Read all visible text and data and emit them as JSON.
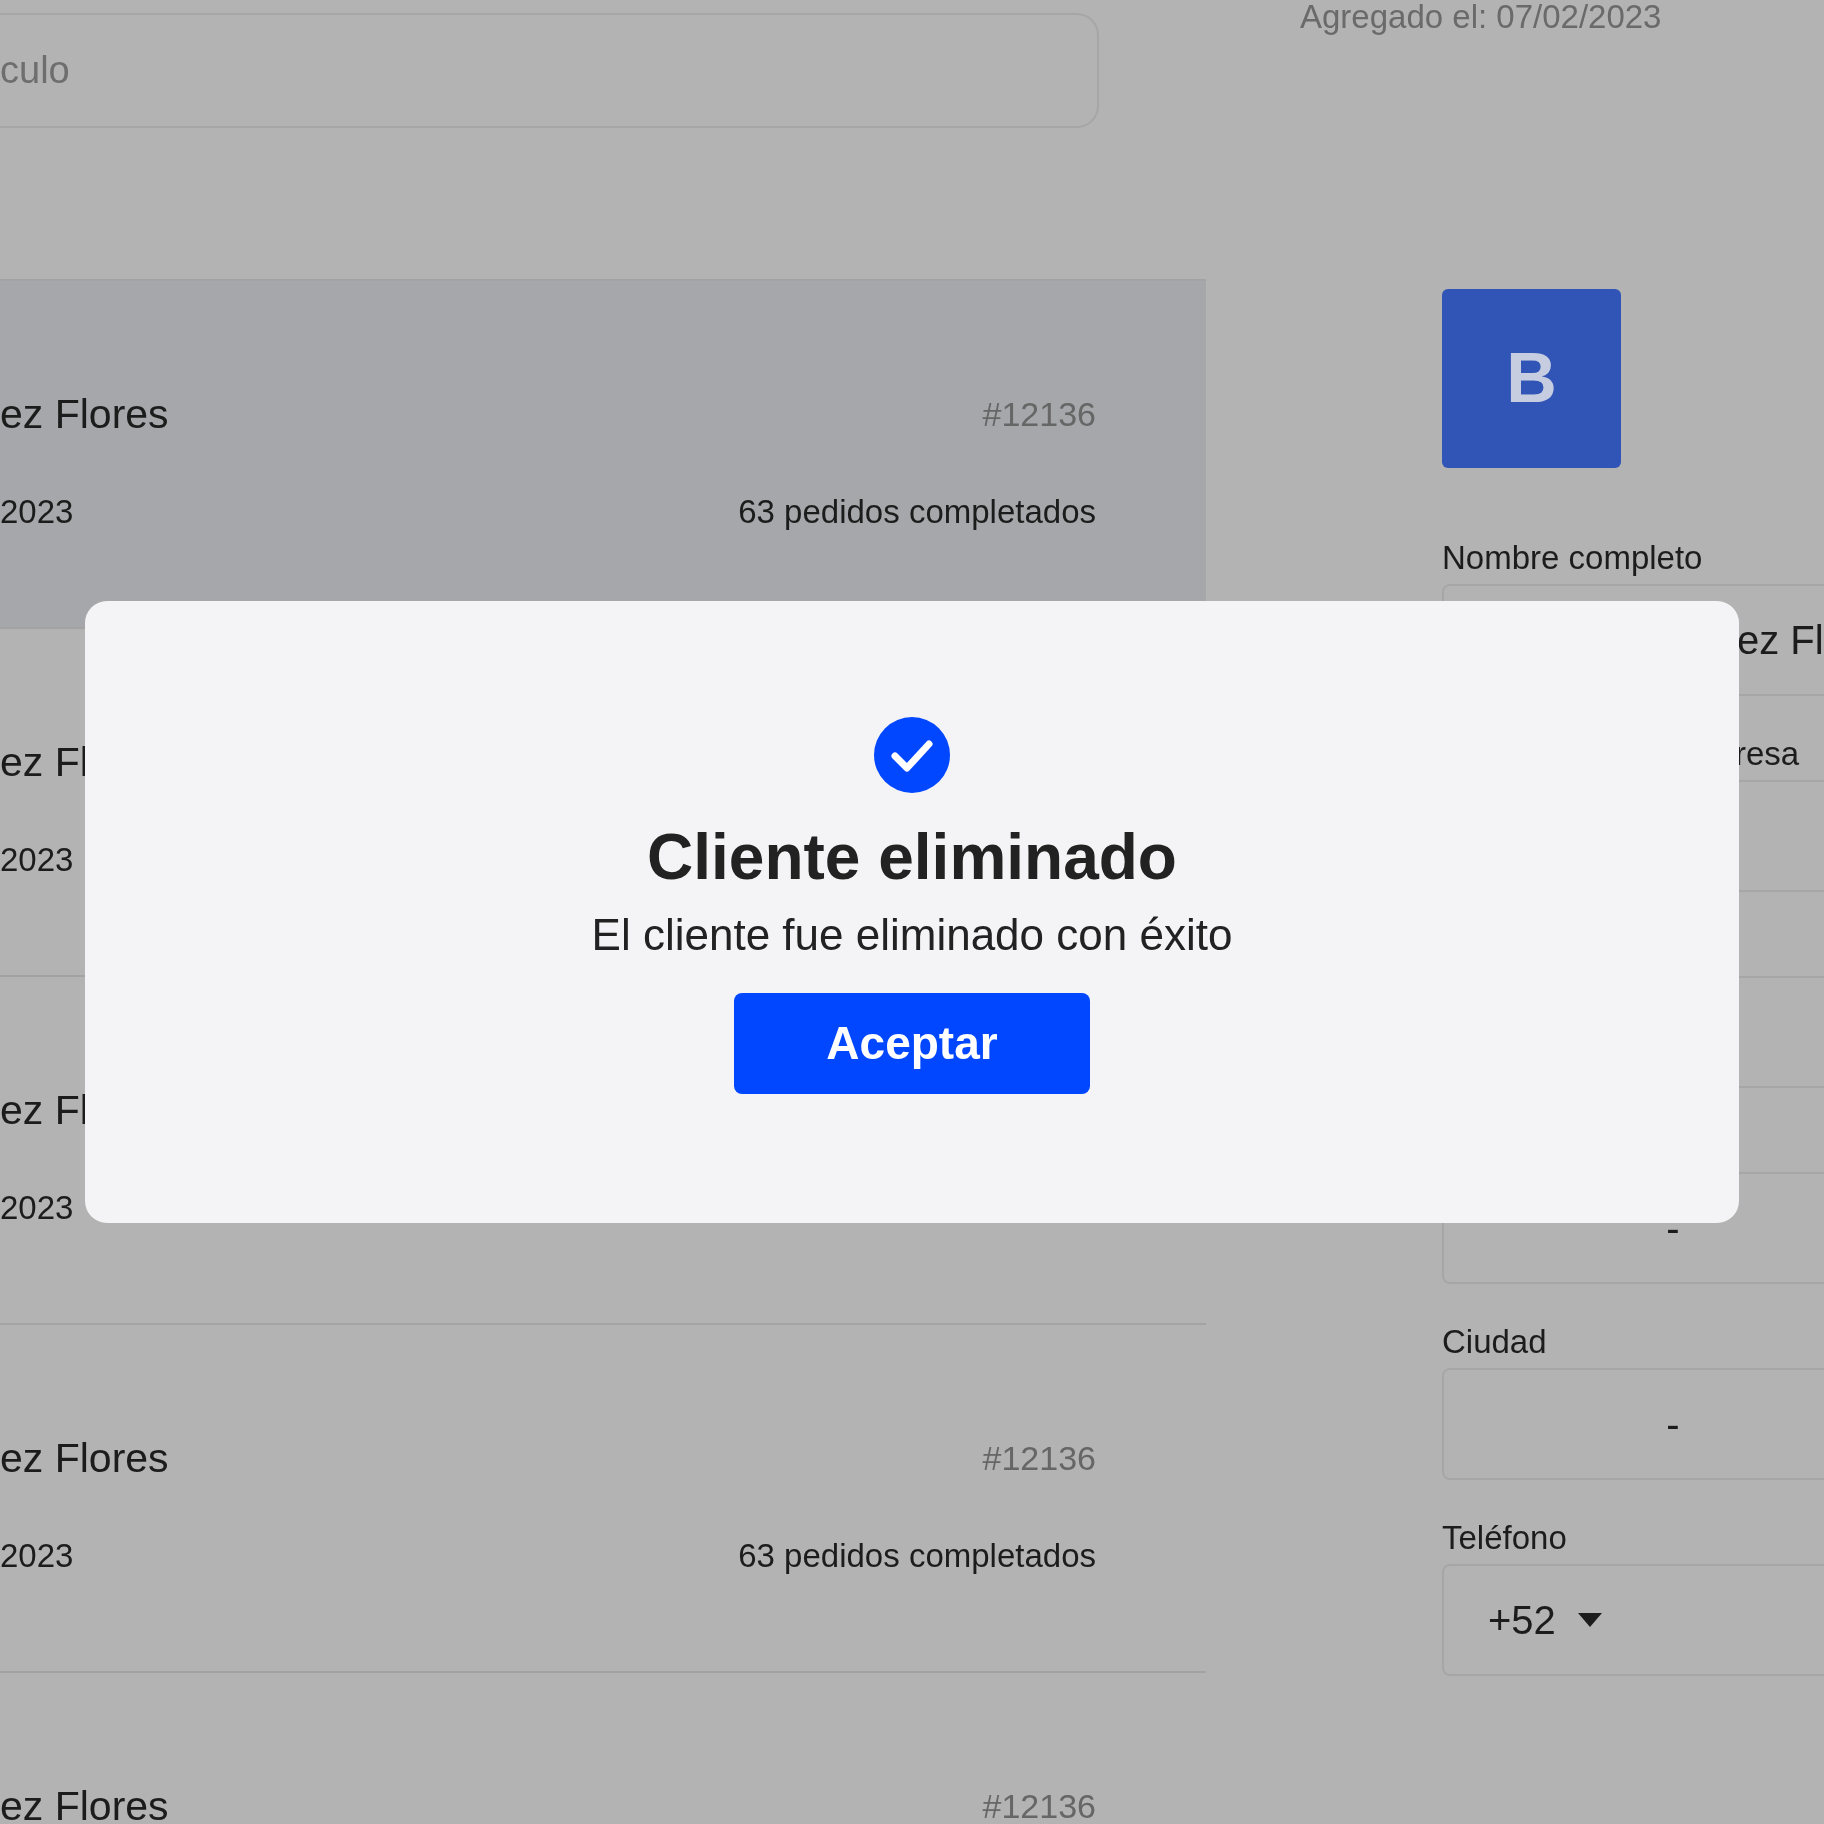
{
  "search": {
    "placeholder": "culo"
  },
  "added": "Agregado el: 07/02/2023",
  "clients": [
    {
      "name": "ez Flores",
      "date": "2023",
      "number": "#12136",
      "orders": "63 pedidos completados",
      "selected": true
    },
    {
      "name": "ez Fl",
      "date": "2023",
      "selected": false
    },
    {
      "name": "ez Fl",
      "date": "2023",
      "selected": false
    },
    {
      "name": "ez Flores",
      "date": "2023",
      "number": "#12136",
      "orders": "63 pedidos completados",
      "selected": false
    },
    {
      "name": "ez Flores",
      "number": "#12136",
      "selected": false
    }
  ],
  "detail": {
    "avatar": "B",
    "fields": [
      {
        "label": "Nombre completo",
        "kind": "text",
        "value": "ez Fl"
      },
      {
        "label": "resa",
        "kind": "text"
      },
      {
        "kind": "text"
      },
      {
        "kind": "text",
        "value": "-"
      },
      {
        "label": "Ciudad",
        "kind": "text",
        "value": "-"
      },
      {
        "label": "Teléfono",
        "kind": "phone",
        "value": "+52"
      }
    ]
  },
  "dialog": {
    "title": "Cliente eliminado",
    "message": "El cliente fue eliminado con éxito",
    "button": "Aceptar"
  }
}
